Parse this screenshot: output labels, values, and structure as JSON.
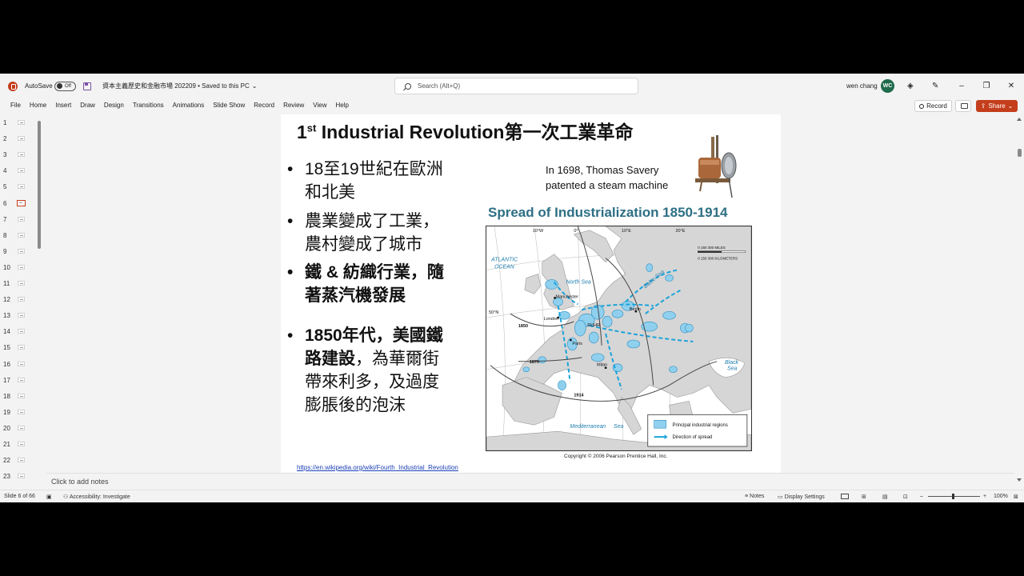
{
  "titlebar": {
    "autosave_label": "AutoSave",
    "autosave_state": "Off",
    "document_title": "資本主義歷史和金融市場 202209 • Saved to this PC",
    "search_placeholder": "Search (Alt+Q)",
    "user_name": "wen chang",
    "user_initials": "WC"
  },
  "ribbon": {
    "tabs": [
      "File",
      "Home",
      "Insert",
      "Draw",
      "Design",
      "Transitions",
      "Animations",
      "Slide Show",
      "Record",
      "Review",
      "View",
      "Help"
    ],
    "record_label": "Record",
    "share_label": "Share"
  },
  "thumbnails": {
    "numbers": [
      "1",
      "2",
      "3",
      "4",
      "5",
      "6",
      "7",
      "8",
      "9",
      "10",
      "11",
      "12",
      "13",
      "14",
      "15",
      "16",
      "17",
      "18",
      "19",
      "20",
      "21",
      "22",
      "23"
    ],
    "active": "6"
  },
  "slide": {
    "title_main": "1",
    "title_sup": "st",
    "title_rest": " Industrial Revolution第一次工業革命",
    "bullets": [
      {
        "text": "18至19世紀在歐洲和北美",
        "bold": false
      },
      {
        "text": "農業變成了工業，農村變成了城市",
        "bold": false
      },
      {
        "text": "鐵 & 紡織行業，隨著蒸汽機發展",
        "bold": true
      }
    ],
    "bullet4_bold": "1850年代，美國鐵路建設",
    "bullet4_rest": "，為華爾街帶來利多，及過度膨脹後的泡沫",
    "steam_line1": "In 1698, Thomas Savery",
    "steam_line2": "patented a steam machine",
    "map_title": "Spread of Industrialization 1850-1914",
    "map_labels": {
      "atlantic": "ATLANTIC",
      "ocean": "OCEAN",
      "north_sea": "North Sea",
      "baltic_sea": "Baltic Sea",
      "black_sea": "Black",
      "black_sea2": "Sea",
      "mediterranean": "Mediterranean",
      "mediterranean2": "Sea",
      "manchester": "Manchester",
      "london": "London",
      "paris": "Paris",
      "berlin": "Berlin",
      "ruhr": "RUHR",
      "milan": "Milan",
      "y1850": "1850",
      "y1870": "1870",
      "y1914": "1914",
      "lat50": "50°N",
      "lon10w": "10°W",
      "lon0": "0°",
      "lon10e": "10°E",
      "lon20e": "20°E",
      "scale_miles": "0    150    300 MILES",
      "scale_km": "0  150  300 KILOMETERS",
      "legend_regions": "Principal industrial regions",
      "legend_spread": "Direction of spread"
    },
    "copyright": "Copyright © 2006 Pearson Prentice Hall, Inc.",
    "link": "https://en.wikipedia.org/wiki/Fourth_Industrial_Revolution"
  },
  "notes": {
    "placeholder": "Click to add notes"
  },
  "statusbar": {
    "slide_counter": "Slide 6 of 66",
    "accessibility": "Accessibility: Investigate",
    "notes_label": "Notes",
    "display_settings": "Display Settings",
    "zoom": "100%"
  },
  "colors": {
    "accent": "#c43e1c",
    "map_title": "#2d6f84",
    "industrial": "#8fd0ee",
    "spread_arrow": "#1aa3d9"
  }
}
